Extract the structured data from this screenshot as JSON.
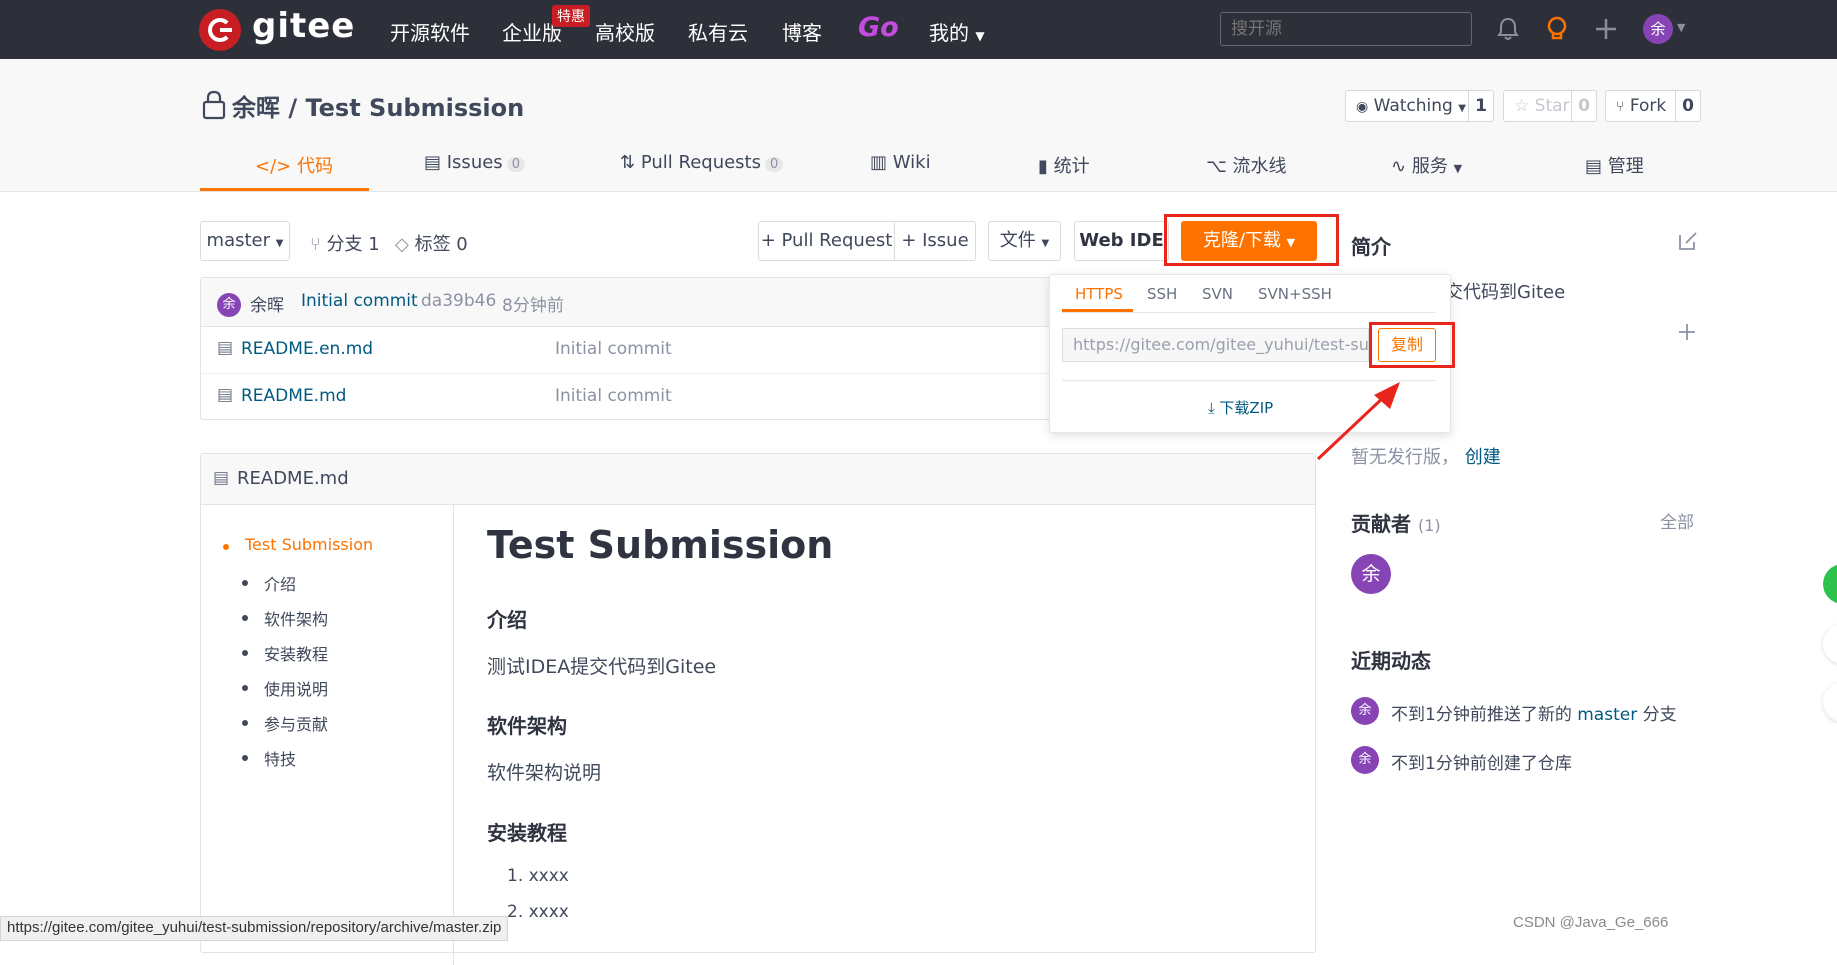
{
  "nav": {
    "logo_text": "gitee",
    "items": [
      "开源软件",
      "企业版",
      "高校版",
      "私有云",
      "博客"
    ],
    "hot_badge": "特惠",
    "go_label": "Go",
    "mine_label": "我的",
    "search_placeholder": "搜开源",
    "avatar_char": "余"
  },
  "repo": {
    "title": "余晖 / Test Submission",
    "watching_label": "Watching",
    "watching_count": "1",
    "star_label": "Star",
    "star_count": "0",
    "fork_label": "Fork",
    "fork_count": "0"
  },
  "tabs": [
    {
      "label": "代码"
    },
    {
      "label": "Issues",
      "count": "0"
    },
    {
      "label": "Pull Requests",
      "count": "0"
    },
    {
      "label": "Wiki"
    },
    {
      "label": "统计"
    },
    {
      "label": "流水线"
    },
    {
      "label": "服务"
    },
    {
      "label": "管理"
    }
  ],
  "controls": {
    "branch": "master",
    "branches": "分支 1",
    "tags": "标签 0",
    "pull_request": "+ Pull Request",
    "issue": "+ Issue",
    "file": "文件",
    "web_ide": "Web IDE",
    "clone": "克隆/下载"
  },
  "commit": {
    "avatar_char": "余",
    "author": "余晖",
    "message": "Initial commit",
    "hash": "da39b46",
    "time": "8分钟前"
  },
  "files": [
    {
      "name": "README.en.md",
      "commit": "Initial commit"
    },
    {
      "name": "README.md",
      "commit": "Initial commit"
    }
  ],
  "clone_dropdown": {
    "tabs": [
      "HTTPS",
      "SSH",
      "SVN",
      "SVN+SSH"
    ],
    "active_tab": "HTTPS",
    "url": "https://gitee.com/gitee_yuhui/test-submission.git",
    "copy_label": "复制",
    "download_zip": "下载ZIP"
  },
  "readme": {
    "header": "README.md",
    "toc": [
      "Test Submission",
      "介绍",
      "软件架构",
      "安装教程",
      "使用说明",
      "参与贡献",
      "特技"
    ],
    "h1": "Test Submission",
    "sections": [
      {
        "heading": "介绍",
        "text": "测试IDEA提交代码到Gitee"
      },
      {
        "heading": "软件架构",
        "text": "软件架构说明"
      },
      {
        "heading": "安装教程"
      }
    ],
    "list_items": [
      "1. xxxx",
      "2. xxxx"
    ]
  },
  "sidebar": {
    "intro_title": "简介",
    "intro_text": "交代码到Gitee",
    "release_text": "暂无发行版，",
    "release_link": "创建",
    "contributors_title": "贡献者",
    "contributors_count": "(1)",
    "all_label": "全部",
    "contributor_avatar": "余",
    "activity_title": "近期动态",
    "activities": [
      {
        "avatar": "余",
        "prefix": "不到1分钟前推送了新的",
        "branch": "master",
        "suffix": "分支"
      },
      {
        "avatar": "余",
        "text": "不到1分钟前创建了仓库"
      }
    ]
  },
  "status_bar_url": "https://gitee.com/gitee_yuhui/test-submission/repository/archive/master.zip",
  "watermark": "CSDN @Java_Ge_666",
  "colors": {
    "accent": "#fe7300",
    "topbar": "#2e3039",
    "brand_red": "#c71d23",
    "avatar_purple": "#8644b5",
    "annotation_red": "#e8251c"
  }
}
